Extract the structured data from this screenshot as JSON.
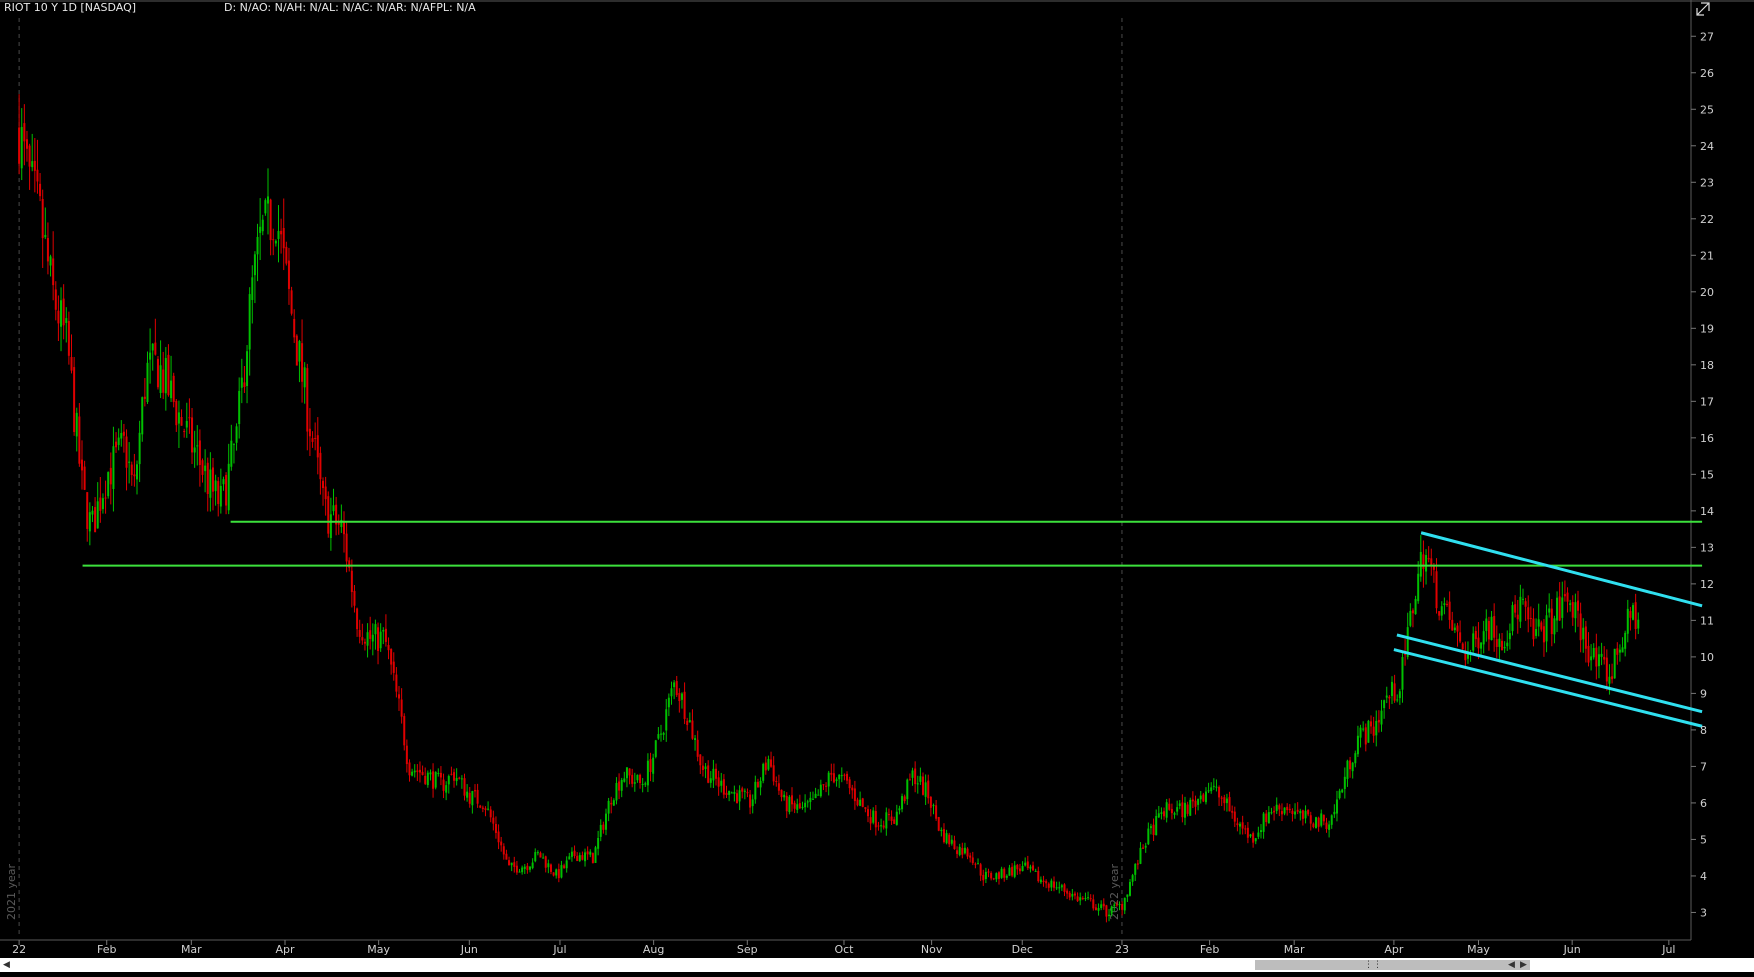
{
  "header": {
    "symbol_label": "RIOT 10 Y 1D [NASDAQ]",
    "study_label": "D: N/AO: N/AH: N/AL: N/AC: N/AR: N/AFPL: N/A"
  },
  "icons": {
    "pane": "maximize-pane-icon",
    "scroll_left": "chevron-left-icon",
    "scroll_right": "chevron-right-icon",
    "scroll_grip": "grip-icon"
  },
  "colors": {
    "background": "#000000",
    "up": "#00c000",
    "down": "#e00000",
    "support": "#3ce03c",
    "channel": "#30e0f0",
    "axis_text": "#d0d0d0",
    "divider": "#5a5a5a"
  },
  "chart_data": {
    "type": "candlestick",
    "ylim": [
      2.3,
      27.5
    ],
    "y_ticks": [
      3,
      4,
      5,
      6,
      7,
      8,
      9,
      10,
      11,
      12,
      13,
      14,
      15,
      16,
      17,
      18,
      19,
      20,
      21,
      22,
      23,
      24,
      25,
      26,
      27
    ],
    "x_ticks": [
      "22",
      "Feb",
      "Mar",
      "Apr",
      "May",
      "Jun",
      "Jul",
      "Aug",
      "Sep",
      "Oct",
      "Nov",
      "Dec",
      "23",
      "Feb",
      "Mar",
      "Apr",
      "May",
      "Jun",
      "Jul"
    ],
    "year_markers": [
      {
        "label": "2021 year",
        "position": "22"
      },
      {
        "label": "2022 year",
        "position": "23"
      }
    ],
    "trend_points": [
      [
        "2022-01-03",
        24.5
      ],
      [
        "2022-01-05",
        23.5
      ],
      [
        "2022-01-10",
        22.0
      ],
      [
        "2022-01-14",
        20.0
      ],
      [
        "2022-01-19",
        18.5
      ],
      [
        "2022-01-24",
        14.5
      ],
      [
        "2022-01-27",
        13.5
      ],
      [
        "2022-02-01",
        15.0
      ],
      [
        "2022-02-07",
        15.8
      ],
      [
        "2022-02-10",
        14.5
      ],
      [
        "2022-02-14",
        17.8
      ],
      [
        "2022-02-18",
        18.0
      ],
      [
        "2022-02-23",
        17.0
      ],
      [
        "2022-02-28",
        16.0
      ],
      [
        "2022-03-03",
        15.5
      ],
      [
        "2022-03-08",
        14.5
      ],
      [
        "2022-03-11",
        14.2
      ],
      [
        "2022-03-16",
        16.0
      ],
      [
        "2022-03-21",
        20.0
      ],
      [
        "2022-03-24",
        21.5
      ],
      [
        "2022-03-29",
        22.2
      ],
      [
        "2022-04-01",
        20.5
      ],
      [
        "2022-04-06",
        18.0
      ],
      [
        "2022-04-11",
        15.5
      ],
      [
        "2022-04-14",
        14.0
      ],
      [
        "2022-04-20",
        13.5
      ],
      [
        "2022-04-25",
        11.0
      ],
      [
        "2022-04-29",
        10.5
      ],
      [
        "2022-05-04",
        10.5
      ],
      [
        "2022-05-09",
        8.5
      ],
      [
        "2022-05-12",
        7.0
      ],
      [
        "2022-05-17",
        6.8
      ],
      [
        "2022-05-23",
        6.5
      ],
      [
        "2022-05-27",
        6.8
      ],
      [
        "2022-06-01",
        6.2
      ],
      [
        "2022-06-06",
        6.0
      ],
      [
        "2022-06-10",
        5.2
      ],
      [
        "2022-06-14",
        4.2
      ],
      [
        "2022-06-20",
        4.3
      ],
      [
        "2022-06-24",
        4.6
      ],
      [
        "2022-06-30",
        4.0
      ],
      [
        "2022-07-06",
        4.6
      ],
      [
        "2022-07-12",
        4.5
      ],
      [
        "2022-07-18",
        6.2
      ],
      [
        "2022-07-22",
        6.8
      ],
      [
        "2022-07-28",
        6.5
      ],
      [
        "2022-08-02",
        7.5
      ],
      [
        "2022-08-08",
        9.3
      ],
      [
        "2022-08-12",
        8.5
      ],
      [
        "2022-08-17",
        7.0
      ],
      [
        "2022-08-23",
        6.5
      ],
      [
        "2022-08-29",
        6.2
      ],
      [
        "2022-09-02",
        6.0
      ],
      [
        "2022-09-08",
        7.2
      ],
      [
        "2022-09-13",
        6.0
      ],
      [
        "2022-09-19",
        5.8
      ],
      [
        "2022-09-23",
        6.0
      ],
      [
        "2022-09-29",
        6.8
      ],
      [
        "2022-10-04",
        6.5
      ],
      [
        "2022-10-10",
        5.8
      ],
      [
        "2022-10-14",
        5.5
      ],
      [
        "2022-10-20",
        5.6
      ],
      [
        "2022-10-26",
        6.8
      ],
      [
        "2022-10-31",
        6.2
      ],
      [
        "2022-11-04",
        5.2
      ],
      [
        "2022-11-09",
        4.8
      ],
      [
        "2022-11-14",
        4.6
      ],
      [
        "2022-11-18",
        4.0
      ],
      [
        "2022-11-23",
        4.0
      ],
      [
        "2022-11-29",
        4.2
      ],
      [
        "2022-12-02",
        4.2
      ],
      [
        "2022-12-07",
        3.9
      ],
      [
        "2022-12-13",
        3.7
      ],
      [
        "2022-12-19",
        3.4
      ],
      [
        "2022-12-23",
        3.3
      ],
      [
        "2022-12-29",
        3.0
      ],
      [
        "2023-01-03",
        3.2
      ],
      [
        "2023-01-06",
        3.9
      ],
      [
        "2023-01-11",
        5.0
      ],
      [
        "2023-01-17",
        5.8
      ],
      [
        "2023-01-23",
        5.8
      ],
      [
        "2023-01-27",
        6.0
      ],
      [
        "2023-02-01",
        6.5
      ],
      [
        "2023-02-06",
        6.0
      ],
      [
        "2023-02-10",
        5.5
      ],
      [
        "2023-02-15",
        5.0
      ],
      [
        "2023-02-21",
        5.8
      ],
      [
        "2023-02-27",
        5.9
      ],
      [
        "2023-03-03",
        5.6
      ],
      [
        "2023-03-08",
        5.5
      ],
      [
        "2023-03-13",
        5.5
      ],
      [
        "2023-03-17",
        6.5
      ],
      [
        "2023-03-22",
        7.8
      ],
      [
        "2023-03-27",
        8.0
      ],
      [
        "2023-03-31",
        8.8
      ],
      [
        "2023-04-05",
        9.2
      ],
      [
        "2023-04-10",
        11.8
      ],
      [
        "2023-04-13",
        13.0
      ],
      [
        "2023-04-18",
        11.5
      ],
      [
        "2023-04-24",
        10.5
      ],
      [
        "2023-04-28",
        10.0
      ],
      [
        "2023-05-03",
        11.0
      ],
      [
        "2023-05-09",
        10.5
      ],
      [
        "2023-05-15",
        11.5
      ],
      [
        "2023-05-19",
        10.5
      ],
      [
        "2023-05-25",
        11.0
      ],
      [
        "2023-05-31",
        11.6
      ],
      [
        "2023-06-05",
        10.5
      ],
      [
        "2023-06-09",
        9.8
      ],
      [
        "2023-06-14",
        9.5
      ],
      [
        "2023-06-16",
        10.2
      ],
      [
        "2023-06-21",
        11.2
      ],
      [
        "2023-06-23",
        11.0
      ]
    ],
    "support_lines": [
      {
        "value": 13.7,
        "from": "2022-03-14",
        "to": "2023-07-14"
      },
      {
        "value": 12.5,
        "from": "2022-01-24",
        "to": "2023-07-14"
      }
    ],
    "channel_lines": [
      {
        "from": [
          "2023-04-12",
          13.4
        ],
        "to": [
          "2023-07-14",
          11.4
        ]
      },
      {
        "from": [
          "2023-04-04",
          10.6
        ],
        "to": [
          "2023-07-14",
          8.5
        ]
      },
      {
        "from": [
          "2023-04-03",
          10.2
        ],
        "to": [
          "2023-07-14",
          8.1
        ]
      }
    ]
  }
}
